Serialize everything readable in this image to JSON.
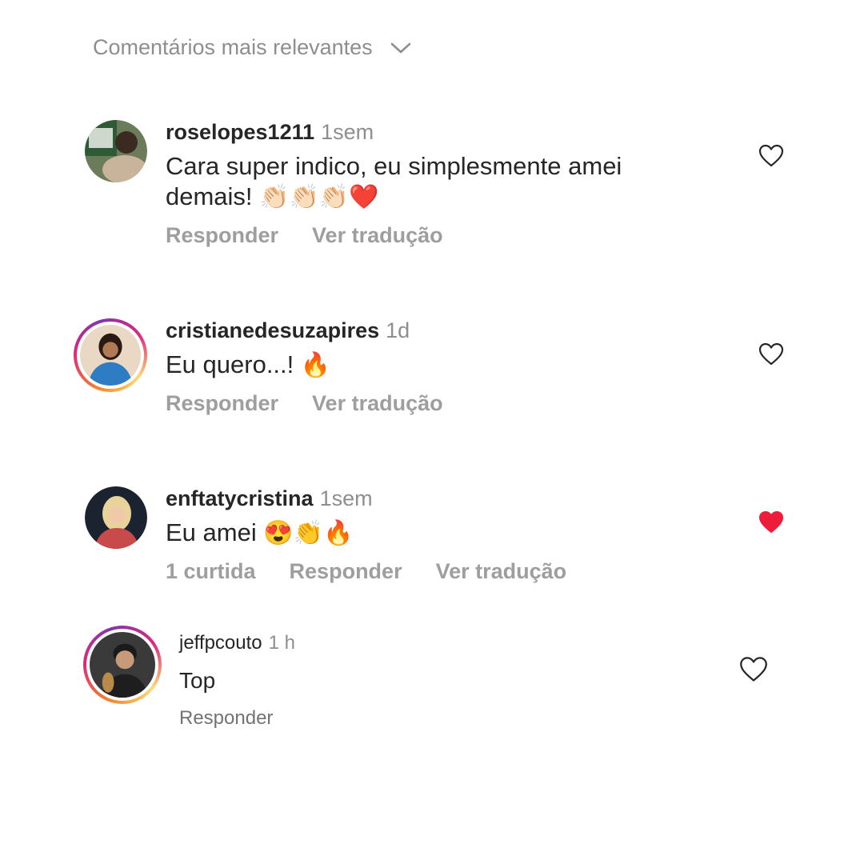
{
  "sort_label": "Comentários mais relevantes",
  "comments": [
    {
      "username": "roselopes1211",
      "time": "1sem",
      "text": "Cara super indico, eu simplesmente amei demais!",
      "emojis": "👏🏻👏🏻👏🏻❤️",
      "liked": false,
      "actions": {
        "reply": "Responder",
        "translate": "Ver tradução"
      }
    },
    {
      "username": "cristianedesuzapires",
      "time": "1d",
      "text": "Eu quero...!",
      "emojis": "🔥",
      "liked": false,
      "actions": {
        "reply": "Responder",
        "translate": "Ver tradução"
      }
    },
    {
      "username": "enftatycristina",
      "time": "1sem",
      "text": "Eu amei",
      "emojis": "😍👏🔥",
      "liked": true,
      "actions": {
        "likes": "1 curtida",
        "reply": "Responder",
        "translate": "Ver tradução"
      }
    },
    {
      "username": "jeffpcouto",
      "time": "1 h",
      "text": "Top",
      "liked": false,
      "actions": {
        "reply": "Responder"
      }
    }
  ],
  "colors": {
    "heart_liked": "#ed1c3b",
    "muted": "#8e8e8e"
  }
}
